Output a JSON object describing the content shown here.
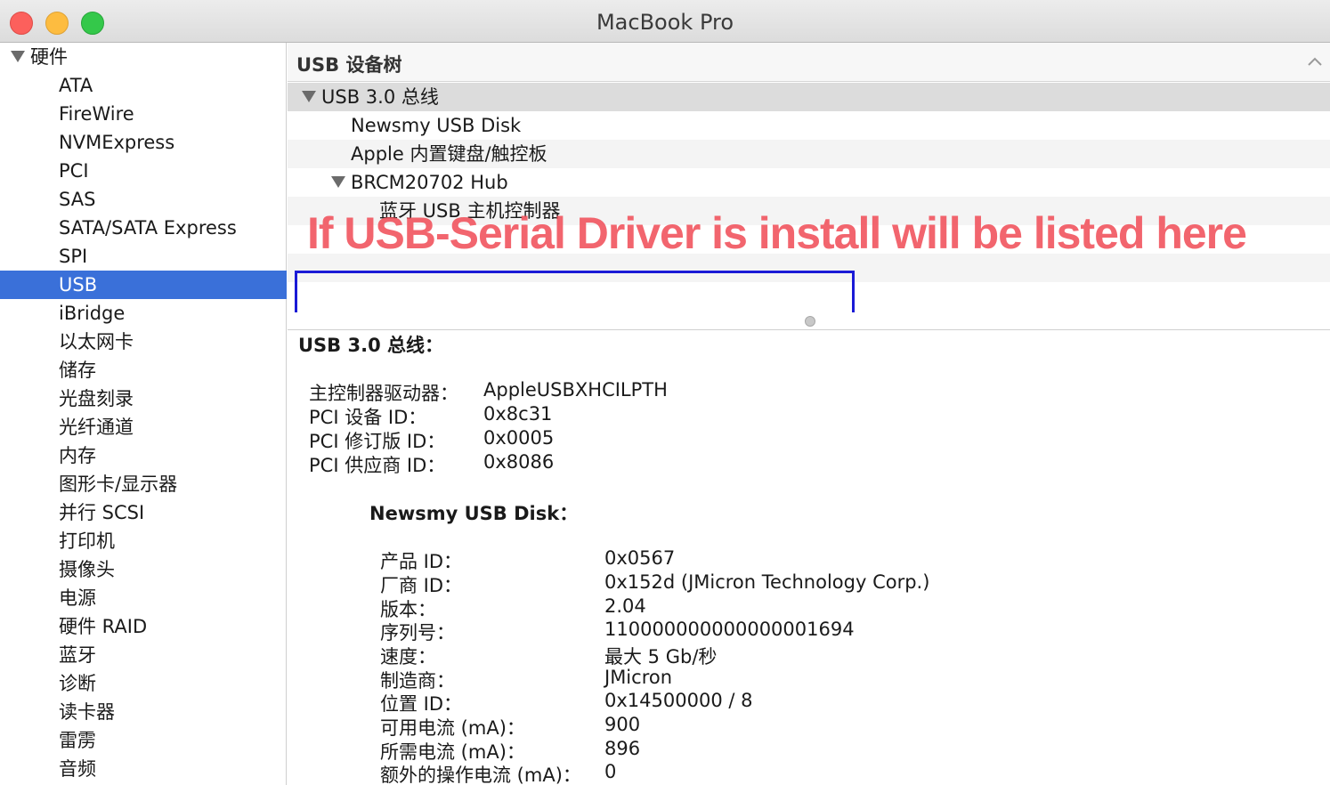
{
  "window": {
    "title": "MacBook Pro"
  },
  "sidebar": {
    "group_label": "硬件",
    "items": [
      {
        "label": "ATA"
      },
      {
        "label": "FireWire"
      },
      {
        "label": "NVMExpress"
      },
      {
        "label": "PCI"
      },
      {
        "label": "SAS"
      },
      {
        "label": "SATA/SATA Express"
      },
      {
        "label": "SPI"
      },
      {
        "label": "USB",
        "selected": true
      },
      {
        "label": "iBridge"
      },
      {
        "label": "以太网卡"
      },
      {
        "label": "储存"
      },
      {
        "label": "光盘刻录"
      },
      {
        "label": "光纤通道"
      },
      {
        "label": "内存"
      },
      {
        "label": "图形卡/显示器"
      },
      {
        "label": "并行 SCSI"
      },
      {
        "label": "打印机"
      },
      {
        "label": "摄像头"
      },
      {
        "label": "电源"
      },
      {
        "label": "硬件 RAID"
      },
      {
        "label": "蓝牙"
      },
      {
        "label": "诊断"
      },
      {
        "label": "读卡器"
      },
      {
        "label": "雷雳"
      },
      {
        "label": "音频"
      }
    ],
    "selection_color": "#3a70d9"
  },
  "pane": {
    "title": "USB 设备树"
  },
  "tree": {
    "rows": [
      {
        "label": "USB 3.0 总线",
        "expanded": true
      },
      {
        "label": "Newsmy USB Disk"
      },
      {
        "label": "Apple 内置键盘/触控板"
      },
      {
        "label": "BRCM20702 Hub",
        "expanded": true
      },
      {
        "label": "蓝牙 USB 主机控制器"
      }
    ]
  },
  "annotation": {
    "text": "If USB-Serial Driver is install will be listed here",
    "text_color": "#f0505a",
    "box_color": "#1a1ad6"
  },
  "details": {
    "bus_heading": "USB 3.0 总线：",
    "bus_props": [
      {
        "key": "主控制器驱动器：",
        "value": "AppleUSBXHCILPTH"
      },
      {
        "key": "PCI 设备 ID：",
        "value": "0x8c31"
      },
      {
        "key": "PCI 修订版 ID：",
        "value": "0x0005"
      },
      {
        "key": "PCI 供应商 ID：",
        "value": "0x8086"
      }
    ],
    "device_heading": "Newsmy USB Disk：",
    "device_props": [
      {
        "key": "产品 ID：",
        "value": "0x0567"
      },
      {
        "key": "厂商 ID：",
        "value": "0x152d  (JMicron Technology Corp.)"
      },
      {
        "key": "版本：",
        "value": "2.04"
      },
      {
        "key": "序列号：",
        "value": "110000000000000001694"
      },
      {
        "key": "速度：",
        "value": "最大 5 Gb/秒"
      },
      {
        "key": "制造商：",
        "value": "JMicron"
      },
      {
        "key": "位置 ID：",
        "value": "0x14500000 / 8"
      },
      {
        "key": "可用电流 (mA)：",
        "value": "900"
      },
      {
        "key": "所需电流 (mA)：",
        "value": "896"
      },
      {
        "key": "额外的操作电流 (mA)：",
        "value": "0"
      }
    ]
  }
}
